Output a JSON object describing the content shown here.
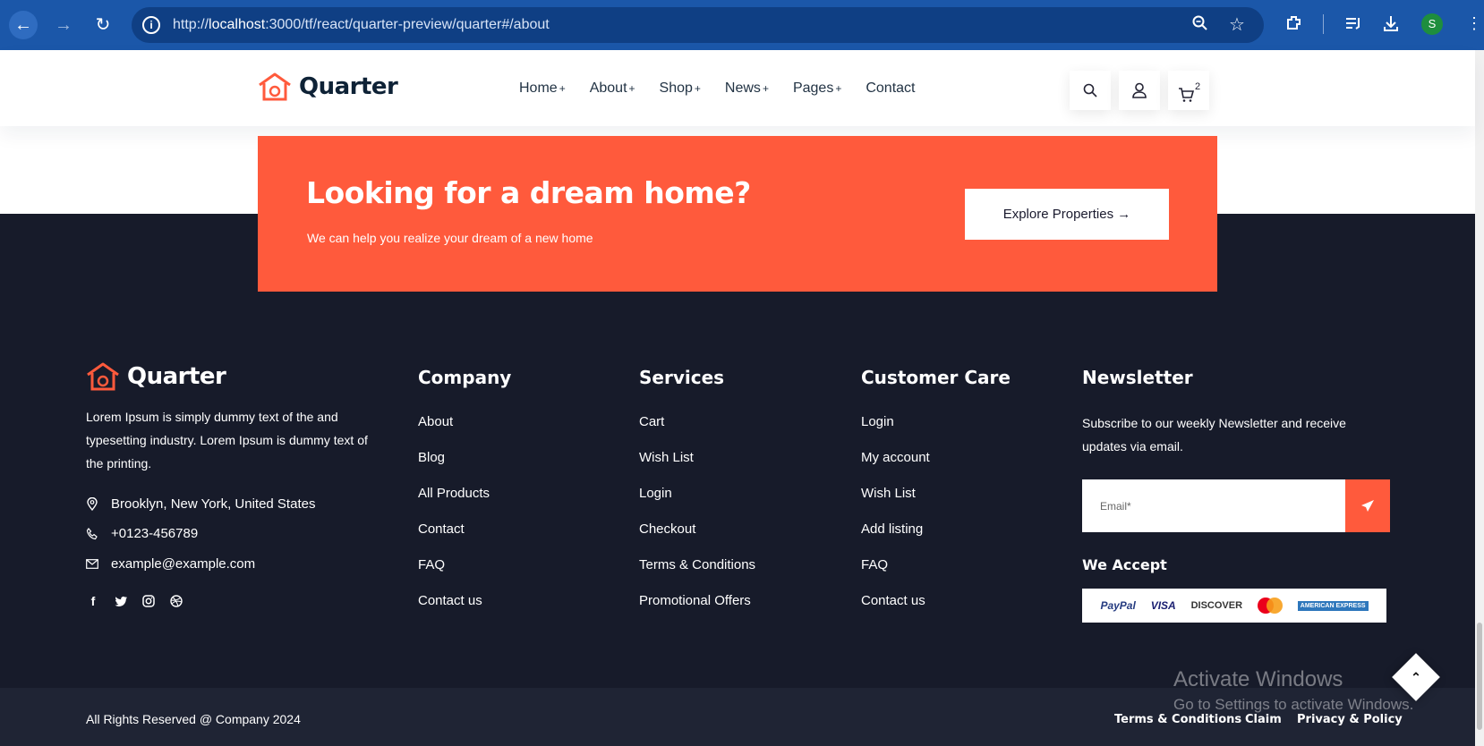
{
  "browser": {
    "url_prefix": "http://",
    "url_host": "localhost",
    "url_rest": ":3000/tf/react/quarter-preview/quarter#/about",
    "profile_initial": "S"
  },
  "header": {
    "brand": "Quarter",
    "nav": [
      {
        "label": "Home",
        "dropdown": "+"
      },
      {
        "label": "About",
        "dropdown": "+"
      },
      {
        "label": "Shop",
        "dropdown": "+"
      },
      {
        "label": "News",
        "dropdown": "+"
      },
      {
        "label": "Pages",
        "dropdown": "+"
      },
      {
        "label": "Contact",
        "dropdown": ""
      }
    ],
    "cart_count": "2"
  },
  "cta": {
    "title": "Looking for a dream home?",
    "subtitle": "We can help you realize your dream of a new home",
    "button": "Explore Properties",
    "arrow": "→"
  },
  "footer": {
    "brand": "Quarter",
    "about": "Lorem Ipsum is simply dummy text of the and typesetting industry. Lorem Ipsum is dummy text of the printing.",
    "address": "Brooklyn, New York, United States",
    "phone": "+0123-456789",
    "email": "example@example.com",
    "socials": [
      "facebook-icon",
      "twitter-icon",
      "instagram-icon",
      "dribbble-icon"
    ],
    "columns": [
      {
        "title": "Company",
        "links": [
          "About",
          "Blog",
          "All Products",
          "Contact",
          "FAQ",
          "Contact us"
        ]
      },
      {
        "title": "Services",
        "links": [
          "Cart",
          "Wish List",
          "Login",
          "Checkout",
          "Terms & Conditions",
          "Promotional Offers"
        ]
      },
      {
        "title": "Customer Care",
        "links": [
          "Login",
          "My account",
          "Wish List",
          "Add listing",
          "FAQ",
          "Contact us"
        ]
      }
    ],
    "newsletter": {
      "title": "Newsletter",
      "text": "Subscribe to our weekly Newsletter and receive updates via email.",
      "placeholder": "Email*",
      "accept_title": "We Accept",
      "payments": [
        "PayPal",
        "VISA",
        "DISCOVER",
        "mastercard",
        "AMERICAN EXPRESS"
      ]
    }
  },
  "bottom": {
    "copyright": "All Rights Reserved @ Company 2024",
    "links": [
      "Terms & Conditions",
      "Claim",
      "Privacy & Policy"
    ]
  },
  "watermark": {
    "title": "Activate Windows",
    "subtitle": "Go to Settings to activate Windows."
  },
  "colors": {
    "accent": "#ff5a3c",
    "footer_bg": "#171b2a",
    "bottom_bg": "#1f2434",
    "chrome_bg": "#1b57a9"
  }
}
